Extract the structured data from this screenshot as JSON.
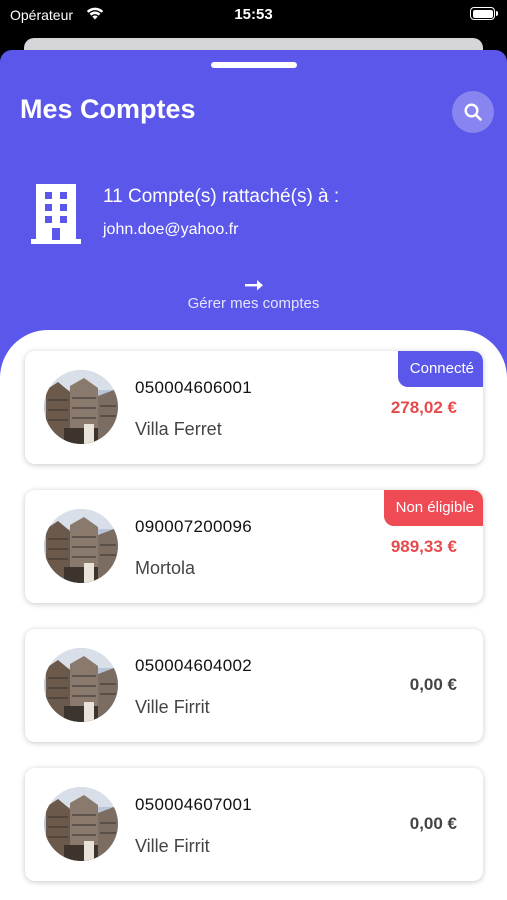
{
  "status_bar": {
    "carrier": "Opérateur",
    "time": "15:53"
  },
  "header": {
    "title": "Mes Comptes",
    "search_icon": "search-icon",
    "attached_label": "11 Compte(s) rattaché(s) à :",
    "email": "john.doe@yahoo.fr",
    "manage_label": "Gérer mes comptes"
  },
  "colors": {
    "primary": "#5a57ea",
    "badge_connected": "#5a57ea",
    "badge_ineligible": "#ee4b55",
    "amount_red": "#e64b4b"
  },
  "accounts": [
    {
      "number": "050004606001",
      "name": "Villa Ferret",
      "amount": "278,02 €",
      "badge": "Connecté"
    },
    {
      "number": "090007200096",
      "name": "Mortola",
      "amount": "989,33 €",
      "badge": "Non éligible"
    },
    {
      "number": "050004604002",
      "name": "Ville Firrit",
      "amount": "0,00 €"
    },
    {
      "number": "050004607001",
      "name": "Ville Firrit",
      "amount": "0,00 €"
    }
  ]
}
